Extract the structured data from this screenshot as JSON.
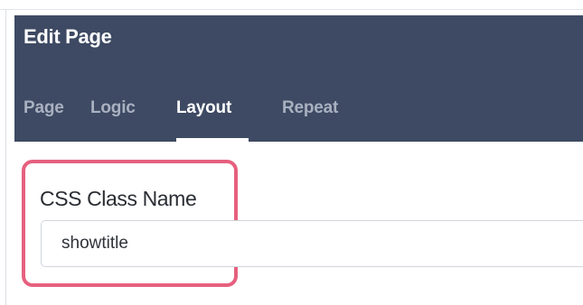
{
  "dialog": {
    "title": "Edit Page",
    "tabs": [
      {
        "label": "Page",
        "active": false
      },
      {
        "label": "Logic",
        "active": false
      },
      {
        "label": "Layout",
        "active": true
      },
      {
        "label": "Repeat",
        "active": false
      }
    ]
  },
  "form": {
    "css_class_label": "CSS Class Name",
    "css_class_value": "showtitle"
  },
  "colors": {
    "header_bg": "#3e4a63",
    "tab_inactive": "#a9b1c1",
    "tab_active": "#ffffff",
    "highlight": "#e6607e"
  }
}
